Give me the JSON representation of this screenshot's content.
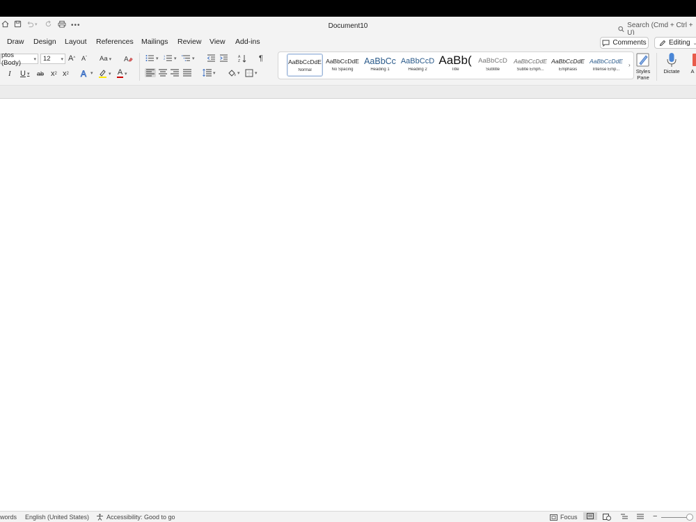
{
  "window": {
    "title": "Document10",
    "search_placeholder": "Search (Cmd + Ctrl + U)"
  },
  "tabs": [
    {
      "label": "Draw"
    },
    {
      "label": "Design"
    },
    {
      "label": "Layout"
    },
    {
      "label": "References"
    },
    {
      "label": "Mailings"
    },
    {
      "label": "Review"
    },
    {
      "label": "View"
    },
    {
      "label": "Add-ins"
    }
  ],
  "actions": {
    "comments_label": "Comments",
    "editing_label": "Editing"
  },
  "font": {
    "family": "ptos (Body)",
    "size": "12"
  },
  "icons": {
    "grow_font": "A",
    "shrink_font": "A",
    "change_case": "Aa",
    "italic": "I",
    "underline": "U",
    "strike": "ab",
    "subscript": "x",
    "superscript": "x",
    "font_color": "A",
    "pilcrow": "¶"
  },
  "styles": [
    {
      "preview": "AaBbCcDdE",
      "name": "Normal"
    },
    {
      "preview": "AaBbCcDdE",
      "name": "No Spacing"
    },
    {
      "preview": "AaBbCc",
      "name": "Heading 1"
    },
    {
      "preview": "AaBbCcD",
      "name": "Heading 2"
    },
    {
      "preview": "AaBb(",
      "name": "Title"
    },
    {
      "preview": "AaBbCcD",
      "name": "Subtitle"
    },
    {
      "preview": "AaBbCcDdE",
      "name": "Subtle Emph..."
    },
    {
      "preview": "AaBbCcDdE",
      "name": "Emphasis"
    },
    {
      "preview": "AaBbCcDdE",
      "name": "Intense Emp..."
    }
  ],
  "ribbon_buttons": {
    "styles_pane": "Styles\nPane",
    "styles_pane_line1": "Styles",
    "styles_pane_line2": "Pane",
    "dictate": "Dictate",
    "more": "A"
  },
  "status": {
    "words": "words",
    "language": "English (United States)",
    "accessibility": "Accessibility: Good to go",
    "focus": "Focus"
  }
}
